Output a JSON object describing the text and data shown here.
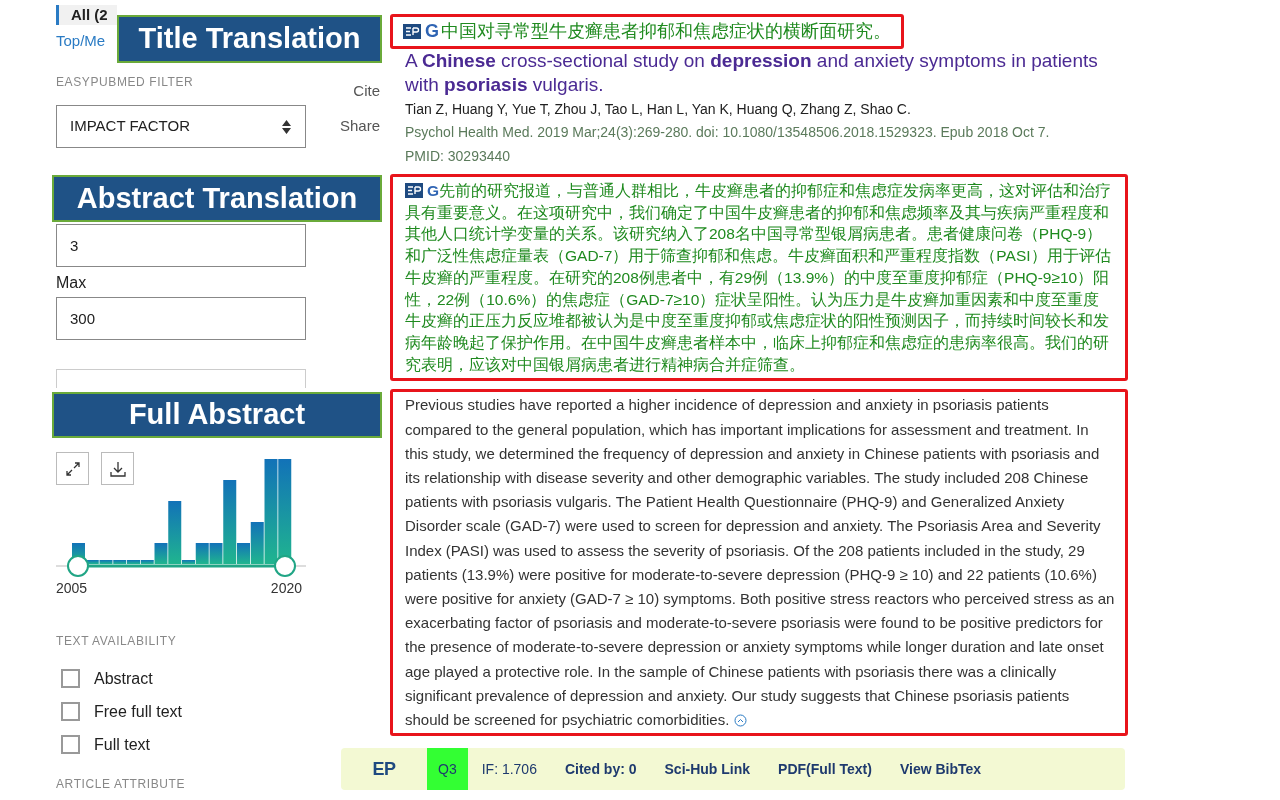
{
  "sidebar": {
    "filter_tab": {
      "label": "All (2",
      "selected": true
    },
    "link": "Top/Me",
    "filter_heading": "EASYPUBMED FILTER",
    "select": {
      "value": "IMPACT FACTOR"
    },
    "min_field": {
      "value": "3"
    },
    "max_label": "Max",
    "max_field": {
      "value": "300"
    },
    "year_range": {
      "start": "2005",
      "end": "2020",
      "level": 1
    },
    "text_availability": {
      "heading": "TEXT AVAILABILITY",
      "options": [
        {
          "label": "Abstract",
          "checked": false
        },
        {
          "label": "Free full text",
          "checked": false
        },
        {
          "label": "Full text",
          "checked": false
        }
      ]
    },
    "next_heading": "ARTICLE ATTRIBUTE"
  },
  "actions": [
    "Cite",
    "Share"
  ],
  "article": {
    "translate_mark": "G",
    "title_translation": "中国对寻常型牛皮癣患者抑郁和焦虑症状的横断面研究。",
    "title": "A **Chinese** cross-sectional study on **depression** and anxiety symptoms in patients with **psoriasis** vulgaris.",
    "authors": "Tian Z, Huang Y, Yue T, Zhou J, Tao L, Han L, Yan K, Huang Q, Zhang Z, Shao C.",
    "citation": "Psychol Health Med. 2019 Mar;24(3):269-280. doi: 10.1080/13548506.2018.1529323. Epub 2018 Oct 7.",
    "pmid": "PMID: 30293440",
    "abstract_translate_mark": "G",
    "abstract_translation": "先前的研究报道，与普通人群相比，牛皮癣患者的抑郁症和焦虑症发病率更高，这对评估和治疗具有重要意义。在这项研究中，我们确定了中国牛皮癣患者的抑郁和焦虑频率及其与疾病严重程度和其他人口统计学变量的关系。该研究纳入了208名中国寻常型银屑病患者。患者健康问卷（PHQ-9）和广泛性焦虑症量表（GAD-7）用于筛查抑郁和焦虑。牛皮癣面积和严重程度指数（PASI）用于评估牛皮癣的严重程度。在研究的208例患者中，有29例（13.9%）的中度至重度抑郁症（PHQ-9≥10）阳性，22例（10.6%）的焦虑症（GAD-7≥10）症状呈阳性。认为压力是牛皮癣加重因素和中度至重度牛皮癣的正压力反应堆都被认为是中度至重度抑郁或焦虑症状的阳性预测因子，而持续时间较长和发病年龄晚起了保护作用。在中国牛皮癣患者样本中，临床上抑郁症和焦虑症的患病率很高。我们的研究表明，应该对中国银屑病患者进行精神病合并症筛查。",
    "abstract": "Previous studies have reported a higher incidence of depression and anxiety in psoriasis patients compared to the general population, which has important implications for assessment and treatment. In this study, we determined the frequency of depression and anxiety in Chinese patients with psoriasis and its relationship with disease severity and other demographic variables. The study included 208 Chinese patients with psoriasis vulgaris. The Patient Health Questionnaire (PHQ-9) and Generalized Anxiety Disorder scale (GAD-7) were used to screen for depression and anxiety. The Psoriasis Area and Severity Index (PASI) was used to assess the severity of psoriasis. Of the 208 patients included in the study, 29 patients (13.9%) were positive for moderate-to-severe depression (PHQ-9 ≥ 10) and 22 patients (10.6%) were positive for anxiety (GAD-7 ≥ 10) symptoms. Both positive stress reactors who perceived stress as an exacerbating factor of psoriasis and moderate-to-severe psoriasis were found to be positive predictors for the presence of moderate-to-severe depression or anxiety symptoms while longer duration and late onset age played a protective role. In the sample of Chinese patients with psoriasis there was a clinically significant prevalence of depression and anxiety. Our study suggests that Chinese psoriasis patients should be screened for psychiatric comorbidities."
  },
  "toolbar": {
    "logo": "EP",
    "items": [
      {
        "label": "Q3",
        "kind": "quartile",
        "color": "#33ff33"
      },
      {
        "label": "IF: 1.706",
        "kind": "info"
      },
      {
        "label": "Cited by: 0",
        "kind": "link"
      },
      {
        "label": "Sci-Hub Link",
        "kind": "link"
      },
      {
        "label": "PDF(Full Text)",
        "kind": "link"
      },
      {
        "label": "View BibTex",
        "kind": "link"
      }
    ]
  },
  "annotations": [
    {
      "label": "Title Translation"
    },
    {
      "label": "Abstract Translation"
    },
    {
      "label": "Full Abstract"
    }
  ]
}
